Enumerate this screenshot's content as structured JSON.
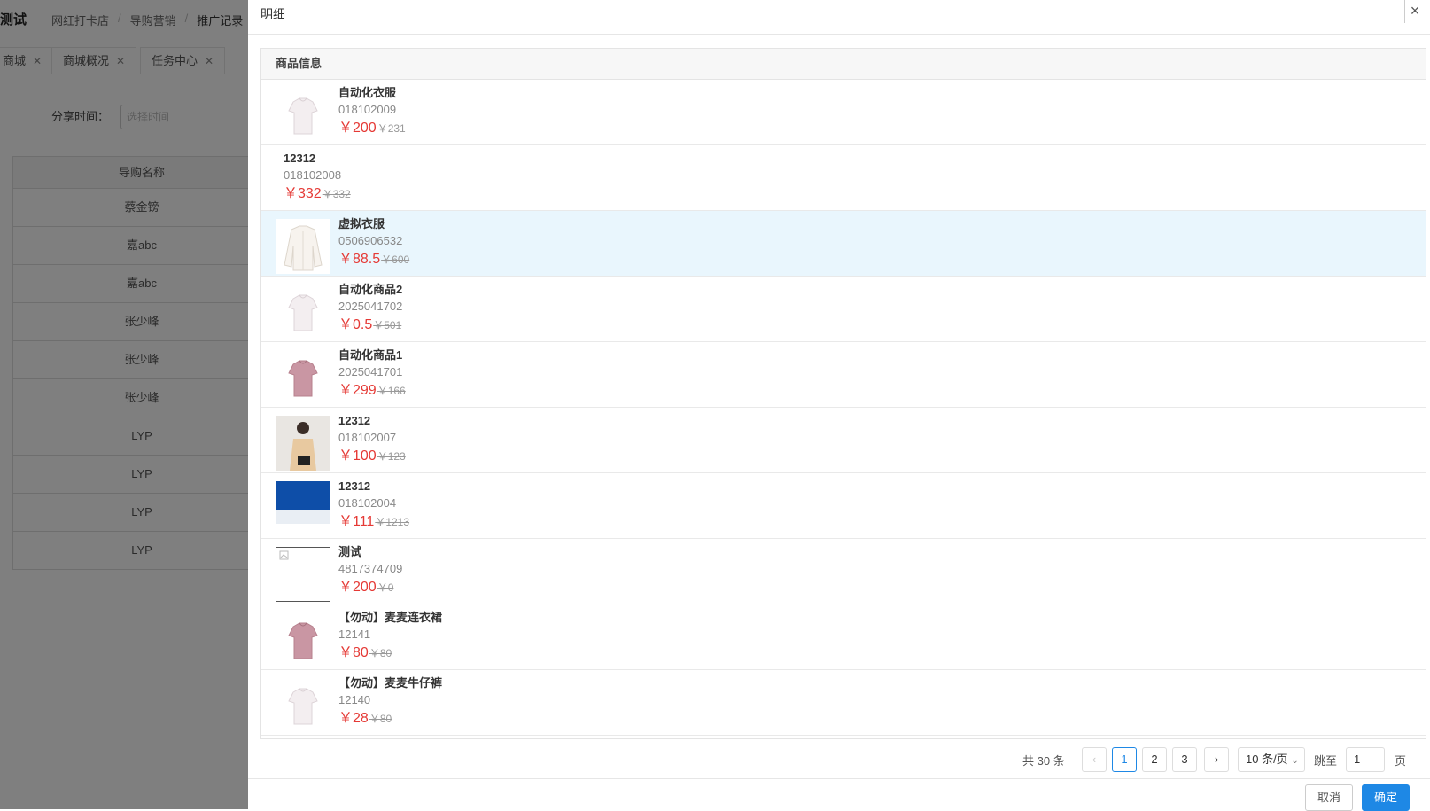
{
  "background": {
    "app_title": "测试",
    "breadcrumb": [
      "网红打卡店",
      "导购营销",
      "推广记录"
    ],
    "tabs": [
      "商城",
      "商城概况",
      "任务中心"
    ],
    "filter_label": "分享时间：",
    "filter_placeholder": "选择时间",
    "table_header": "导购名称",
    "table_rows": [
      "蔡金镑",
      "嘉abc",
      "嘉abc",
      "张少峰",
      "张少峰",
      "张少峰",
      "LYP",
      "LYP",
      "LYP",
      "LYP"
    ]
  },
  "drawer": {
    "title": "明细",
    "close_icon": "×",
    "column_header": "商品信息",
    "items": [
      {
        "name": "自动化衣服",
        "code": "018102009",
        "price": "￥200",
        "original": "￥231",
        "thumb": "white-shirt"
      },
      {
        "name": "12312",
        "code": "018102008",
        "price": "￥332",
        "original": "￥332",
        "thumb": "none"
      },
      {
        "name": "虚拟衣服",
        "code": "0506906532",
        "price": "￥88.5",
        "original": "￥600",
        "thumb": "white-blouse"
      },
      {
        "name": "自动化商品2",
        "code": "2025041702",
        "price": "￥0.5",
        "original": "￥501",
        "thumb": "white-shirt"
      },
      {
        "name": "自动化商品1",
        "code": "2025041701",
        "price": "￥299",
        "original": "￥166",
        "thumb": "pink-shirt"
      },
      {
        "name": "12312",
        "code": "018102007",
        "price": "￥100",
        "original": "￥123",
        "thumb": "model-photo"
      },
      {
        "name": "12312",
        "code": "018102004",
        "price": "￥111",
        "original": "￥1213",
        "thumb": "blue-banner"
      },
      {
        "name": "测试",
        "code": "4817374709",
        "price": "￥200",
        "original": "￥0",
        "thumb": "broken-image"
      },
      {
        "name": "【勿动】麦麦连衣裙",
        "code": "12141",
        "price": "￥80",
        "original": "￥80",
        "thumb": "pink-shirt"
      },
      {
        "name": "【勿动】麦麦牛仔裤",
        "code": "12140",
        "price": "￥28",
        "original": "￥80",
        "thumb": "white-shirt"
      }
    ],
    "highlighted_row": 2,
    "pagination": {
      "total": "共 30 条",
      "prev": "‹",
      "pages": [
        "1",
        "2",
        "3"
      ],
      "current": "1",
      "next": "›",
      "page_size": "10 条/页",
      "jump_label": "跳至",
      "jump_value": "1",
      "jump_suffix": "页"
    },
    "cancel_label": "取消",
    "confirm_label": "确定"
  }
}
